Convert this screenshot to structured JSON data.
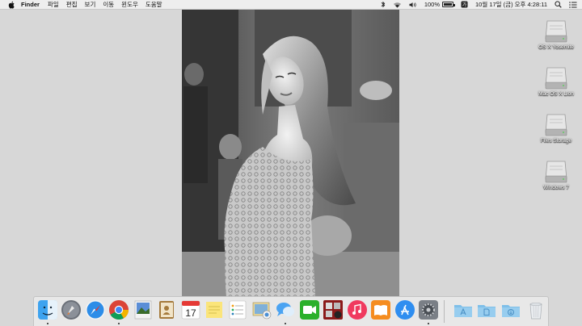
{
  "menubar": {
    "app_name": "Finder",
    "menus": [
      "파일",
      "편집",
      "보기",
      "이동",
      "윈도우",
      "도움말"
    ],
    "battery_text": "100%",
    "datetime": "10월 17일 (금) 오후 4:28:11"
  },
  "desktop_icons": [
    {
      "label": "OS X Yosemite"
    },
    {
      "label": "Mac OS X Lion"
    },
    {
      "label": "Files Storage"
    },
    {
      "label": "Windows 7"
    }
  ],
  "dock": {
    "apps": [
      "Finder",
      "Launchpad",
      "Safari",
      "Google Chrome",
      "Preview",
      "Contacts",
      "Calendar",
      "Stickies",
      "Reminders",
      "Photo Browser",
      "Messages",
      "FaceTime",
      "Photo Booth",
      "iTunes",
      "iBooks",
      "App Store",
      "System Preferences"
    ],
    "calendar_day": "17",
    "stacks": [
      "Applications",
      "Documents",
      "Downloads",
      "Trash"
    ]
  }
}
